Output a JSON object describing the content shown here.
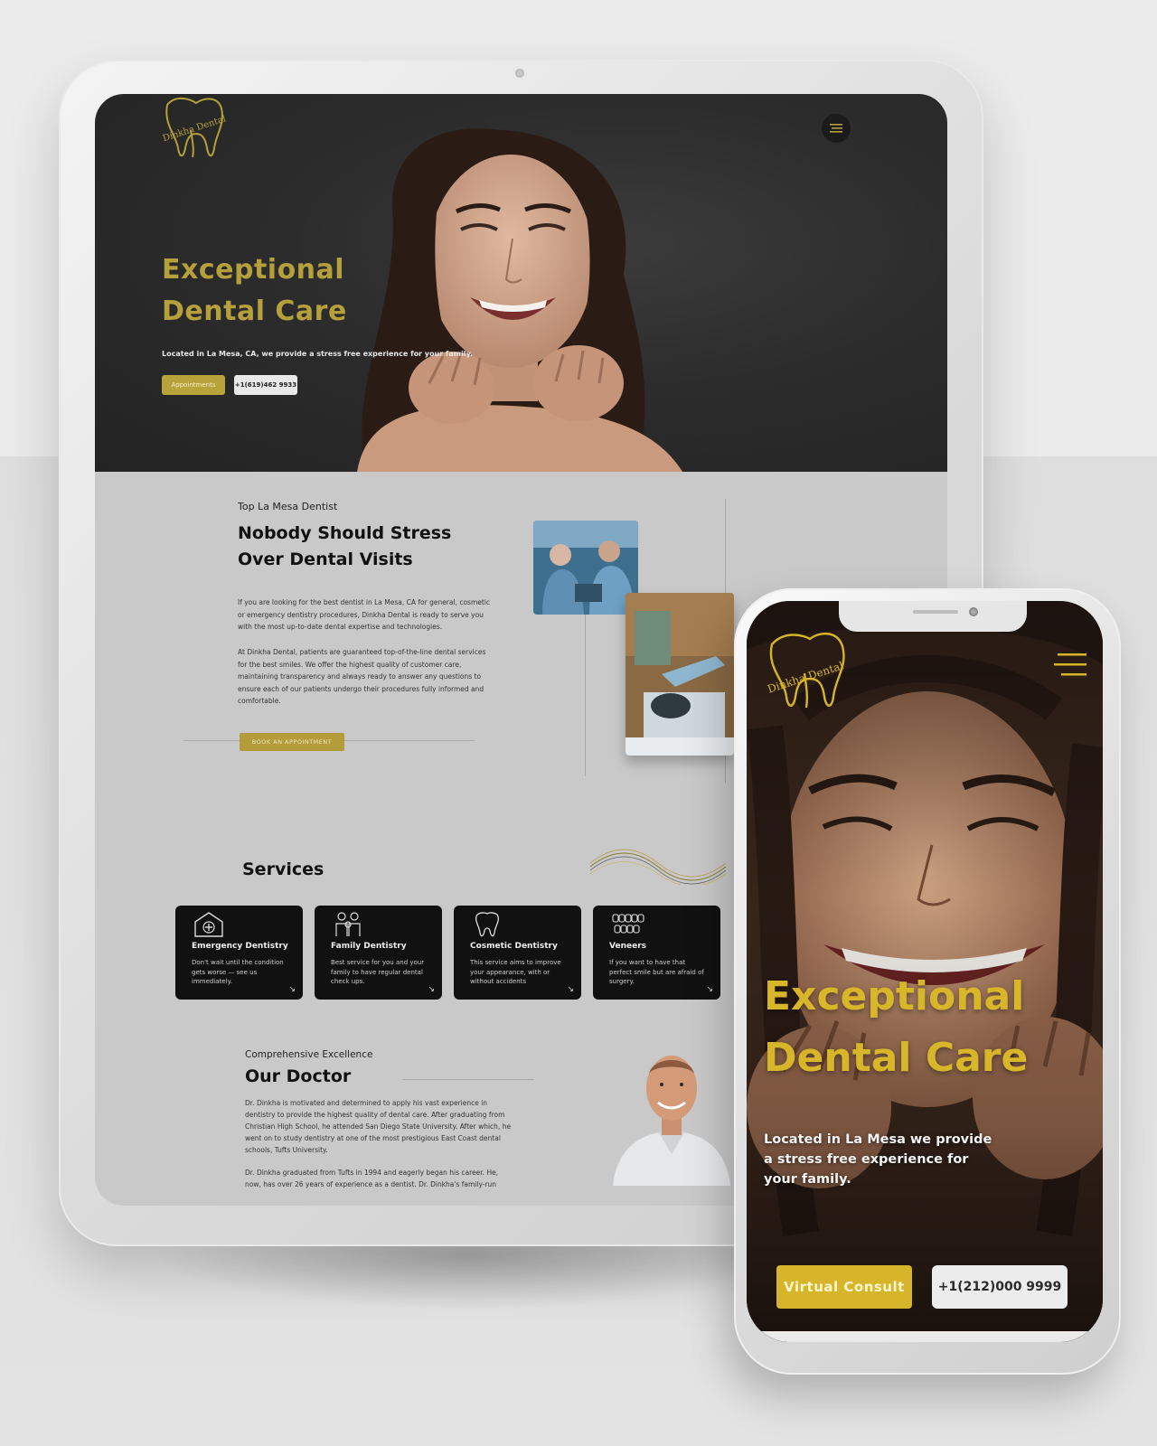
{
  "brand": {
    "name": "Dinkha Dental",
    "gold": "#b8a33a",
    "dark": "#111111"
  },
  "tablet": {
    "hero": {
      "title_line1": "Exceptional",
      "title_line2": "Dental Care",
      "subtitle": "Located in La Mesa, CA, we provide a stress free experience for your family.",
      "primary_button": "Appointments",
      "secondary_button": "+1(619)462 9933",
      "menu_icon": "hamburger-icon"
    },
    "about": {
      "kicker": "Top La Mesa Dentist",
      "title_line1": "Nobody Should Stress",
      "title_line2": "Over Dental Visits",
      "paragraph1": "If you are looking for the best dentist in La Mesa, CA for general, cosmetic or emergency dentistry procedures, Dinkha Dental is ready to serve you with the most up-to-date dental expertise and technologies.",
      "paragraph2": "At Dinkha Dental, patients are guaranteed top-of-the-line dental services for the best smiles. We offer the highest quality of customer care, maintaining transparency and always ready to answer any questions to ensure each of our patients undergo their procedures fully informed and comfortable.",
      "button": "BOOK AN APPOINTMENT"
    },
    "services": {
      "title": "Services",
      "items": [
        {
          "title": "Emergency Dentistry",
          "desc": "Don't wait until the condition gets worse — see us immediately.",
          "icon": "hospital-icon"
        },
        {
          "title": "Family Dentistry",
          "desc": "Best service for you and your family to have regular dental check ups.",
          "icon": "family-icon"
        },
        {
          "title": "Cosmetic Dentistry",
          "desc": "This service aims to improve your appearance, with or without accidents",
          "icon": "tooth-icon"
        },
        {
          "title": "Veneers",
          "desc": "If you want to have that perfect smile but are afraid of surgery.",
          "icon": "veneers-icon"
        }
      ]
    },
    "doctor": {
      "kicker": "Comprehensive Excellence",
      "title": "Our Doctor",
      "paragraph1": "Dr. Dinkha is motivated and determined to apply his vast experience in dentistry to provide the highest quality of dental care. After graduating from Christian High School, he attended San Diego State University. After which, he went on to study dentistry at one of the most prestigious East Coast dental schools, Tufts University.",
      "paragraph2": "Dr. Dinkha graduated from Tufts in 1994 and eagerly began his career. He, now, has over 26 years of experience as a dentist. Dr. Dinkha's family-run"
    }
  },
  "phone": {
    "hero": {
      "title_line1": "Exceptional",
      "title_line2": "Dental Care",
      "subtitle": "Located in La Mesa we provide a stress free experience for your family.",
      "primary_button": "Virtual Consult",
      "secondary_button": "+1(212)000 9999",
      "menu_icon": "hamburger-icon"
    }
  }
}
